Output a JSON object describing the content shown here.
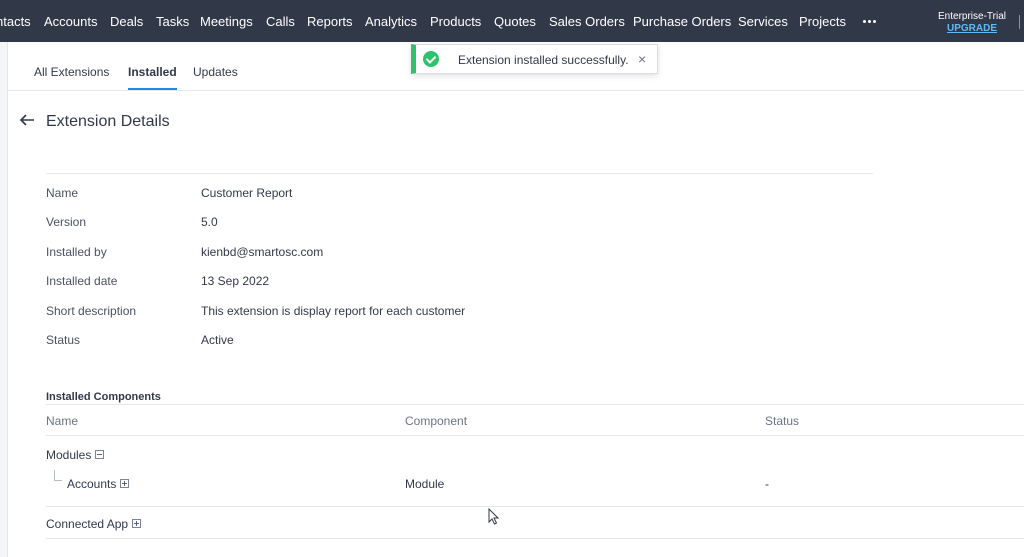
{
  "nav": {
    "items": [
      "ntacts",
      "Accounts",
      "Deals",
      "Tasks",
      "Meetings",
      "Calls",
      "Reports",
      "Analytics",
      "Products",
      "Quotes",
      "Sales Orders",
      "Purchase Orders",
      "Services",
      "Projects"
    ],
    "more_icon": "more-horizontal-icon",
    "trial_label": "Enterprise-Trial",
    "upgrade_label": "UPGRADE"
  },
  "tabs": [
    {
      "label": "All Extensions",
      "active": false
    },
    {
      "label": "Installed",
      "active": true
    },
    {
      "label": "Updates",
      "active": false
    }
  ],
  "toast": {
    "message": "Extension installed successfully.",
    "close_label": "×",
    "icon": "check-circle-icon",
    "color": "#2ec26a"
  },
  "page": {
    "back_icon": "arrow-left-icon",
    "title": "Extension Details"
  },
  "details": [
    {
      "label": "Name",
      "value": "Customer Report"
    },
    {
      "label": "Version",
      "value": "5.0"
    },
    {
      "label": "Installed by",
      "value": "kienbd@smartosc.com"
    },
    {
      "label": "Installed date",
      "value": "13 Sep 2022"
    },
    {
      "label": "Short description",
      "value": "This extension is display report for each customer"
    },
    {
      "label": "Status",
      "value": "Active"
    }
  ],
  "components": {
    "heading": "Installed Components",
    "columns": [
      "Name",
      "Component",
      "Status"
    ],
    "groups": [
      {
        "name": "Modules",
        "expanded": true,
        "children": [
          {
            "name": "Accounts",
            "component": "Module",
            "status": "-"
          }
        ]
      },
      {
        "name": "Connected App",
        "expanded": false,
        "children": []
      }
    ]
  },
  "colors": {
    "nav_bg": "#313949",
    "accent": "#1e88e5",
    "success": "#2ec26a",
    "link": "#5fb9f5"
  }
}
